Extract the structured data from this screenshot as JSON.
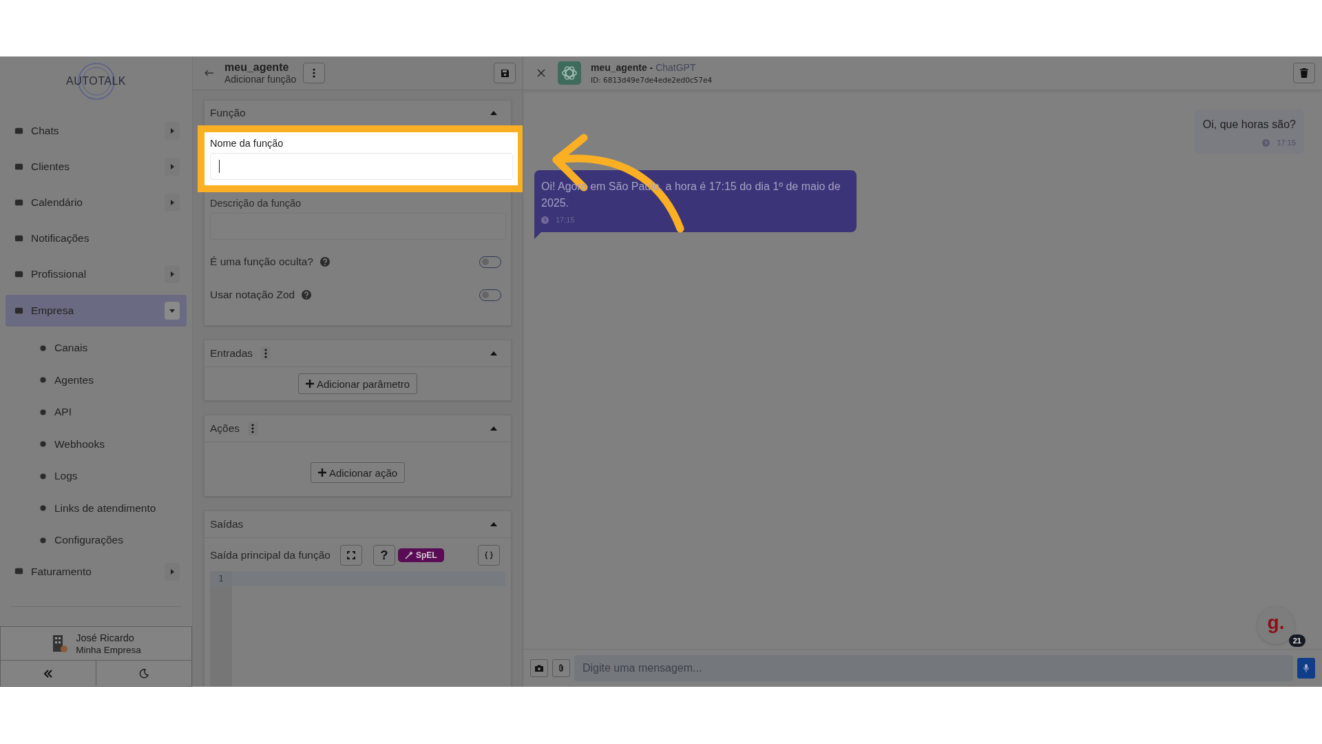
{
  "sidebar": {
    "logo": "AUTOTALK",
    "items": [
      {
        "label": "Chats",
        "kind": "group",
        "expanded": false,
        "selected": false
      },
      {
        "label": "Clientes",
        "kind": "group",
        "expanded": false,
        "selected": false
      },
      {
        "label": "Calendário",
        "kind": "group",
        "expanded": false,
        "selected": false
      },
      {
        "label": "Notificações",
        "kind": "link",
        "selected": false
      },
      {
        "label": "Profissional",
        "kind": "group",
        "expanded": false,
        "selected": false
      },
      {
        "label": "Empresa",
        "kind": "group",
        "expanded": true,
        "selected": true,
        "children": [
          {
            "label": "Canais"
          },
          {
            "label": "Agentes"
          },
          {
            "label": "API"
          },
          {
            "label": "Webhooks"
          },
          {
            "label": "Logs"
          },
          {
            "label": "Links de atendimento"
          },
          {
            "label": "Configurações"
          }
        ]
      },
      {
        "label": "Faturamento",
        "kind": "group",
        "expanded": false,
        "selected": false
      }
    ],
    "user": {
      "name": "José Ricardo",
      "company": "Minha Empresa"
    }
  },
  "editor": {
    "title": "meu_agente",
    "subtitle": "Adicionar função",
    "function_card": {
      "title": "Função",
      "expanded": true,
      "fields": [
        {
          "label": "Nome da função",
          "highlighted": true
        },
        {
          "label": "Descrição da função",
          "highlighted": false
        }
      ],
      "toggles": [
        {
          "label": "É uma função oculta?",
          "on": false
        },
        {
          "label": "Usar notação Zod",
          "on": false
        }
      ]
    },
    "inputs_card": {
      "title": "Entradas",
      "expanded": true,
      "button": "Adicionar parâmetro"
    },
    "actions_card": {
      "title": "Ações",
      "expanded": true,
      "button": "Adicionar ação"
    },
    "outputs_card": {
      "title": "Saídas",
      "expanded": true,
      "output_label": "Saída principal da função",
      "help_button": "?",
      "spel_tag": "SpEL",
      "line_numbers": [
        "1"
      ]
    }
  },
  "chat": {
    "agent_name": "meu_agente -",
    "agent_model": "ChatGPT",
    "agent_id": "ID: 6813d49e7de4ede2ed0c57e4",
    "messages": [
      {
        "kind": "sent",
        "text": "Oi, que horas são?",
        "time": "17:15"
      },
      {
        "kind": "received",
        "text": "Oi! Agora em São Paulo, a hora é 17:15 do dia 1º de maio de 2025.",
        "time": "17:15"
      }
    ],
    "input_placeholder": "Digite uma mensagem...",
    "widget": {
      "logo": "g.",
      "count": "21"
    }
  }
}
